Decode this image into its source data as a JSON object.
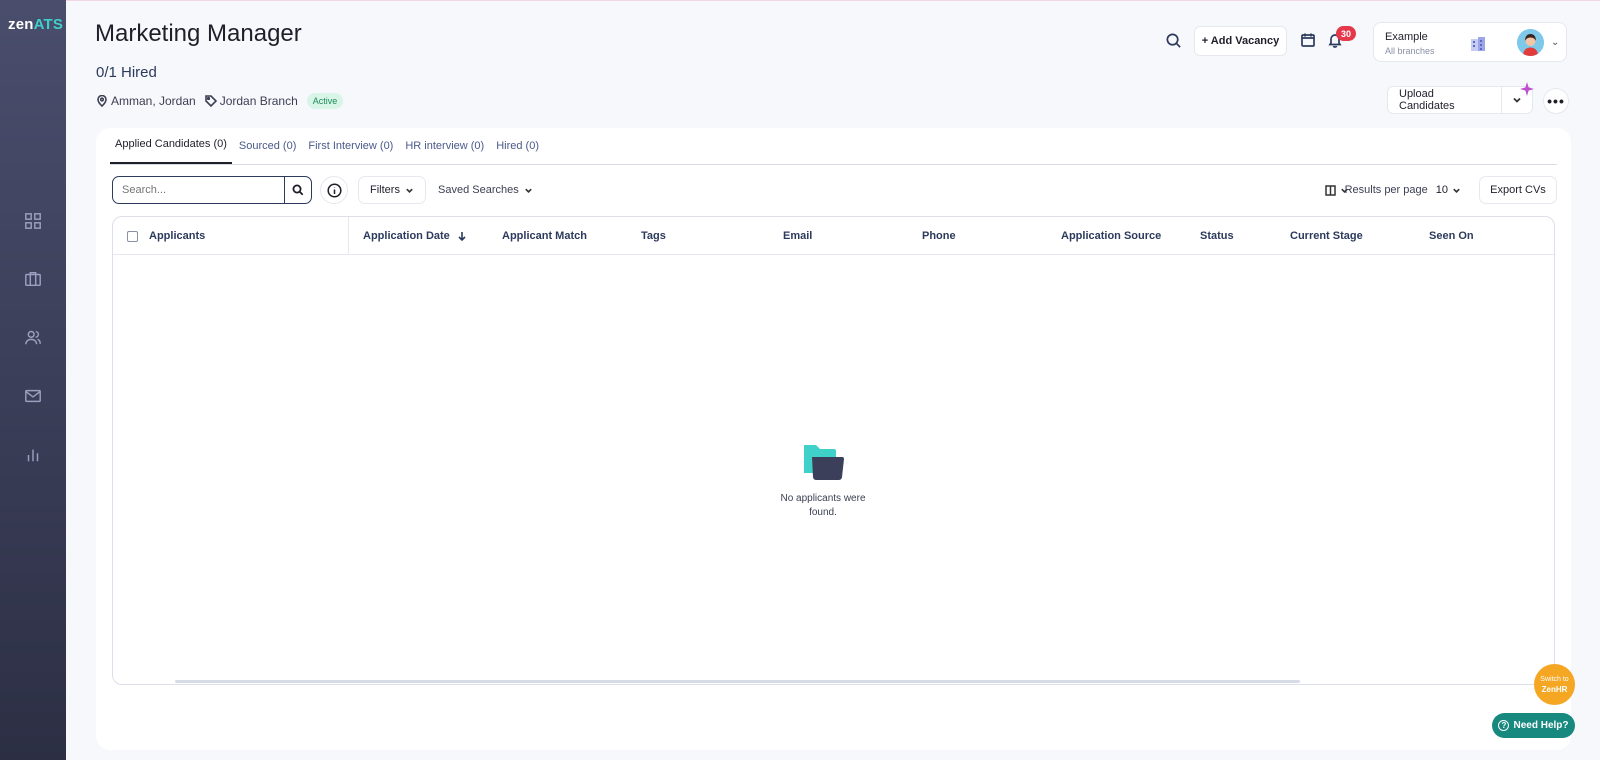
{
  "brand": {
    "logo_zen": "zen",
    "logo_ats": "ATS"
  },
  "sidebar": {
    "items": [
      {
        "icon": "dashboard-icon"
      },
      {
        "icon": "briefcase-icon"
      },
      {
        "icon": "users-icon"
      },
      {
        "icon": "mail-icon"
      },
      {
        "icon": "bar-chart-icon"
      }
    ]
  },
  "header": {
    "title": "Marketing Manager",
    "hired": "0/1 Hired",
    "location": "Amman, Jordan",
    "branch": "Jordan Branch",
    "status": "Active",
    "add_vacancy": "+ Add Vacancy",
    "notifications": "30",
    "account_name": "Example",
    "account_branches": "All branches",
    "upload": "Upload Candidates"
  },
  "tabs": [
    {
      "label": "Applied Candidates (0)",
      "active": true
    },
    {
      "label": "Sourced (0)"
    },
    {
      "label": "First Interview (0)"
    },
    {
      "label": "HR interview (0)"
    },
    {
      "label": "Hired (0)"
    }
  ],
  "toolbar": {
    "search_placeholder": "Search...",
    "filters": "Filters",
    "saved_searches": "Saved Searches",
    "results_per_page": "Results per page",
    "results_value": "10",
    "export": "Export CVs"
  },
  "table": {
    "columns": [
      "Applicants",
      "Application Date",
      "Applicant Match",
      "Tags",
      "Email",
      "Phone",
      "Application Source",
      "Status",
      "Current Stage",
      "Seen On"
    ],
    "empty_text": "No applicants were found."
  },
  "floating": {
    "switch_top": "Switch to",
    "switch_bottom": "ZenHR",
    "help": "Need Help?"
  },
  "colors": {
    "accent_teal": "#3fd0c9",
    "sidebar": "#3b3f5a",
    "notif": "#e5384a",
    "help": "#17897f",
    "switch": "#f5a623"
  }
}
